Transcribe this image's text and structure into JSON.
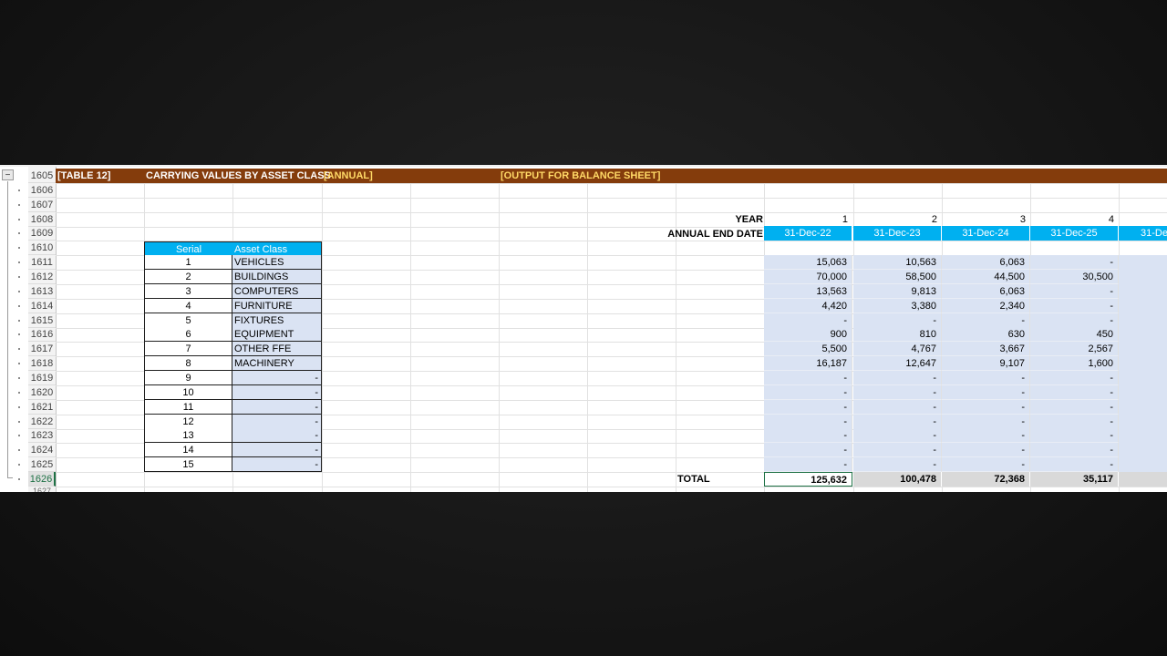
{
  "title_row": {
    "table": "[TABLE 12]",
    "name": "CARRYING VALUES BY ASSET CLASS",
    "period": "[ANNUAL]",
    "purpose": "[OUTPUT FOR BALANCE SHEET]"
  },
  "row_numbers": [
    "1605",
    "1606",
    "1607",
    "1608",
    "1609",
    "1610",
    "1611",
    "1612",
    "1613",
    "1614",
    "1615",
    "1616",
    "1617",
    "1618",
    "1619",
    "1620",
    "1621",
    "1622",
    "1623",
    "1624",
    "1625",
    "1626"
  ],
  "next_row_peek": "1627",
  "outline": {
    "collapse_label": "−"
  },
  "header": {
    "year_label": "YEAR",
    "end_date_label": "ANNUAL END DATE",
    "years": [
      "1",
      "2",
      "3",
      "4"
    ],
    "dates": [
      "31-Dec-22",
      "31-Dec-23",
      "31-Dec-24",
      "31-Dec-25",
      "31-De"
    ]
  },
  "asset_table": {
    "col_serial": "Serial",
    "col_class": "Asset Class",
    "rows": [
      {
        "serial": "1",
        "name": "VEHICLES"
      },
      {
        "serial": "2",
        "name": "BUILDINGS"
      },
      {
        "serial": "3",
        "name": "COMPUTERS"
      },
      {
        "serial": "4",
        "name": "FURNITURE"
      },
      {
        "serial": "5",
        "name": "FIXTURES"
      },
      {
        "serial": "6",
        "name": "EQUIPMENT"
      },
      {
        "serial": "7",
        "name": "OTHER FFE"
      },
      {
        "serial": "8",
        "name": "MACHINERY"
      },
      {
        "serial": "9",
        "name": "-"
      },
      {
        "serial": "10",
        "name": "-"
      },
      {
        "serial": "11",
        "name": "-"
      },
      {
        "serial": "12",
        "name": "-"
      },
      {
        "serial": "13",
        "name": "-"
      },
      {
        "serial": "14",
        "name": "-"
      },
      {
        "serial": "15",
        "name": "-"
      }
    ]
  },
  "values": [
    [
      "15,063",
      "10,563",
      "6,063",
      "-"
    ],
    [
      "70,000",
      "58,500",
      "44,500",
      "30,500"
    ],
    [
      "13,563",
      "9,813",
      "6,063",
      "-"
    ],
    [
      "4,420",
      "3,380",
      "2,340",
      "-"
    ],
    [
      "-",
      "-",
      "-",
      "-"
    ],
    [
      "900",
      "810",
      "630",
      "450"
    ],
    [
      "5,500",
      "4,767",
      "3,667",
      "2,567"
    ],
    [
      "16,187",
      "12,647",
      "9,107",
      "1,600"
    ],
    [
      "-",
      "-",
      "-",
      "-"
    ],
    [
      "-",
      "-",
      "-",
      "-"
    ],
    [
      "-",
      "-",
      "-",
      "-"
    ],
    [
      "-",
      "-",
      "-",
      "-"
    ],
    [
      "-",
      "-",
      "-",
      "-"
    ],
    [
      "-",
      "-",
      "-",
      "-"
    ],
    [
      "-",
      "-",
      "-",
      "-"
    ]
  ],
  "total": {
    "label": "TOTAL",
    "values": [
      "125,632",
      "100,478",
      "72,368",
      "35,117"
    ]
  },
  "colors": {
    "title_bar": "#843c0c",
    "header_blue": "#00b0f0",
    "input_lavender": "#dae3f3",
    "total_gray": "#d9d9d9",
    "title_yellow": "#ffd966"
  }
}
